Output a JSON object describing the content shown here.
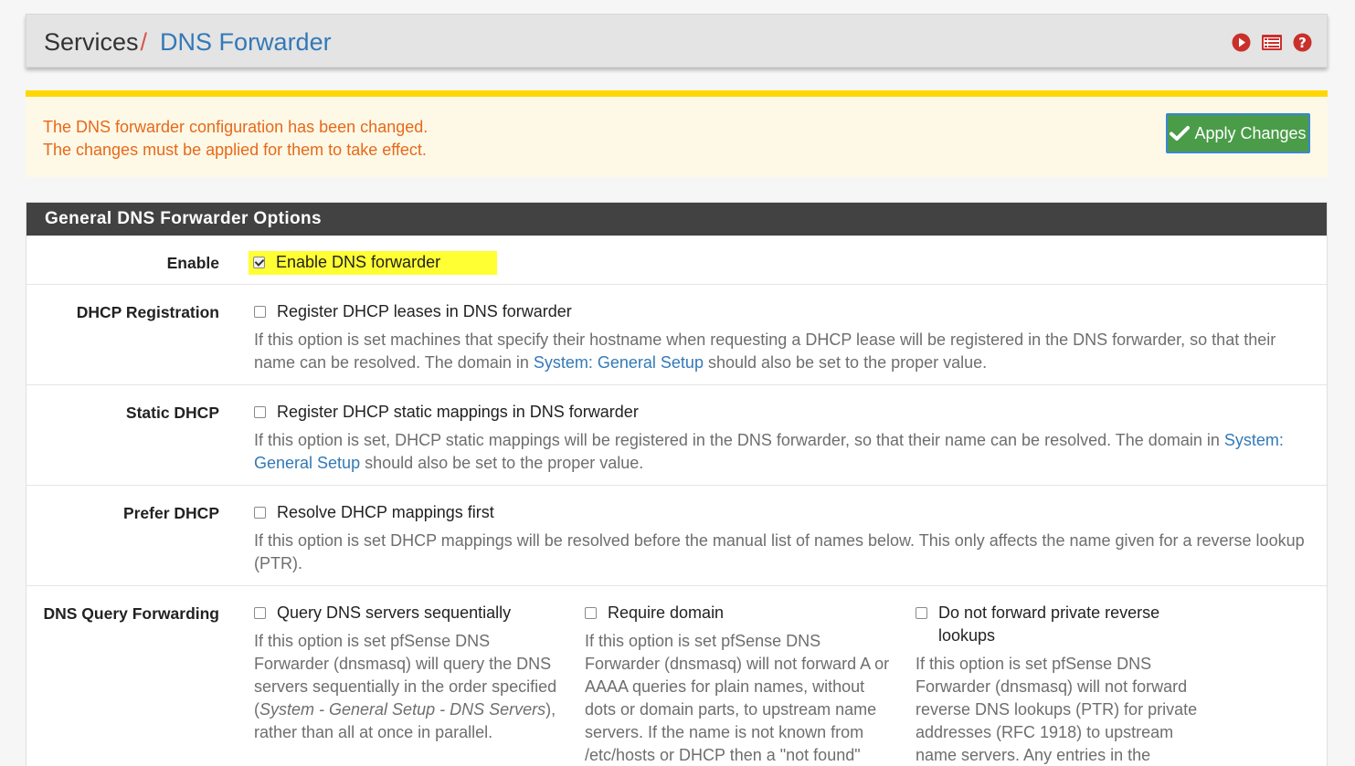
{
  "header": {
    "root": "Services",
    "separator": "/",
    "current": "DNS Forwarder",
    "icons": [
      "play-circle-icon",
      "log-list-icon",
      "help-icon"
    ]
  },
  "alert": {
    "line1": "The DNS forwarder configuration has been changed.",
    "line2": "The changes must be applied for them to take effect.",
    "apply_label": "Apply Changes"
  },
  "panel": {
    "title": "General DNS Forwarder Options",
    "enable": {
      "label": "Enable",
      "checkbox": "Enable DNS forwarder",
      "checked": true
    },
    "dhcp_registration": {
      "label": "DHCP Registration",
      "checkbox": "Register DHCP leases in DNS forwarder",
      "help_pre": "If this option is set machines that specify their hostname when requesting a DHCP lease will be registered in the DNS forwarder, so that their name can be resolved. The domain in ",
      "help_link": "System: General Setup",
      "help_post": " should also be set to the proper value."
    },
    "static_dhcp": {
      "label": "Static DHCP",
      "checkbox": "Register DHCP static mappings in DNS forwarder",
      "help_pre": "If this option is set, DHCP static mappings will be registered in the DNS forwarder, so that their name can be resolved. The domain in ",
      "help_link": "System: General Setup",
      "help_post": " should also be set to the proper value."
    },
    "prefer_dhcp": {
      "label": "Prefer DHCP",
      "checkbox": "Resolve DHCP mappings first",
      "help": "If this option is set DHCP mappings will be resolved before the manual list of names below. This only affects the name given for a reverse lookup (PTR)."
    },
    "dns_query_forwarding": {
      "label": "DNS Query Forwarding",
      "options": [
        {
          "checkbox": "Query DNS servers sequentially",
          "help_pre": "If this option is set pfSense DNS Forwarder (dnsmasq) will query the DNS servers sequentially in the order specified (",
          "help_em": "System - General Setup - DNS Servers",
          "help_post": "), rather than all at once in parallel."
        },
        {
          "checkbox": "Require domain",
          "help": "If this option is set pfSense DNS Forwarder (dnsmasq) will not forward A or AAAA queries for plain names, without dots or domain parts, to upstream name servers. If the name is not known from /etc/hosts or DHCP then a \"not found\""
        },
        {
          "checkbox": "Do not forward private reverse lookups",
          "help": "If this option is set pfSense DNS Forwarder (dnsmasq) will not forward reverse DNS lookups (PTR) for private addresses (RFC 1918) to upstream name servers. Any entries in the Domain"
        }
      ]
    }
  },
  "colors": {
    "accent": "#3379b7",
    "alert_text": "#e8681a",
    "alert_border": "#ffd700",
    "apply_bg": "#4a9c48",
    "highlight": "#ffff33",
    "panel_head": "#424242"
  }
}
